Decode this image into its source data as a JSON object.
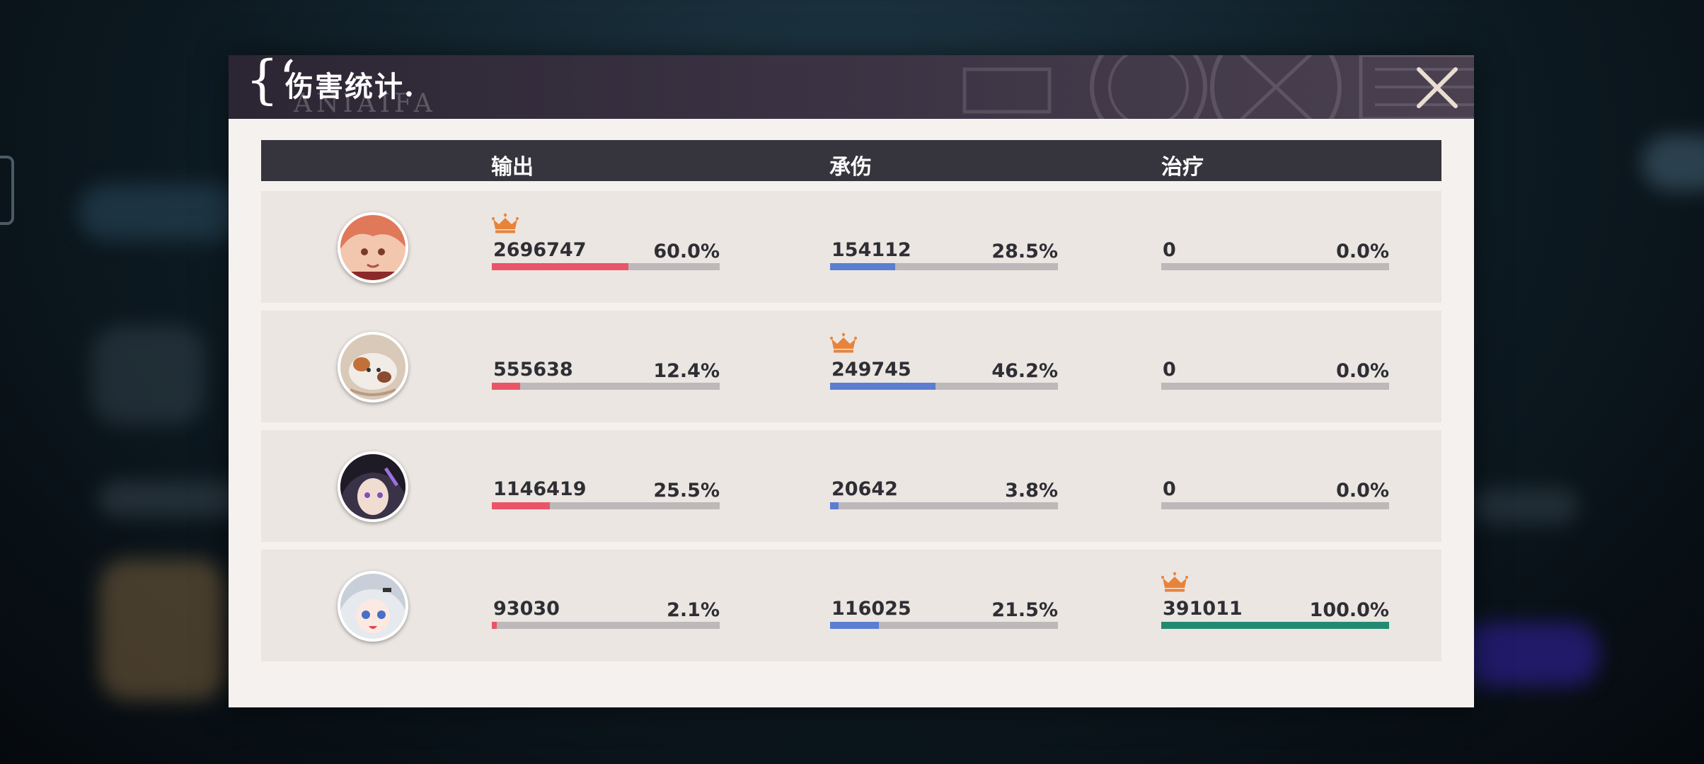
{
  "dialog": {
    "title": "伤害统计",
    "brace": "{‘",
    "title_dot": ".",
    "ghost_text": "ANIAIFA"
  },
  "columns": {
    "output": "输出",
    "damage_taken": "承伤",
    "healing": "治疗"
  },
  "colors": {
    "output_bar": "#ea5468",
    "damage_taken_bar": "#5b7ed3",
    "healing_bar": "#238a72",
    "crown": "#e8833a"
  },
  "rows": [
    {
      "avatar": "character-portrait-orange-hair",
      "output": {
        "value": "2696747",
        "percent_label": "60.0%",
        "fraction": 0.6,
        "top": true
      },
      "damage_taken": {
        "value": "154112",
        "percent_label": "28.5%",
        "fraction": 0.285,
        "top": false
      },
      "healing": {
        "value": "0",
        "percent_label": "0.0%",
        "fraction": 0.0,
        "top": false
      }
    },
    {
      "avatar": "character-portrait-white-cat",
      "output": {
        "value": "555638",
        "percent_label": "12.4%",
        "fraction": 0.124,
        "top": false
      },
      "damage_taken": {
        "value": "249745",
        "percent_label": "46.2%",
        "fraction": 0.462,
        "top": true
      },
      "healing": {
        "value": "0",
        "percent_label": "0.0%",
        "fraction": 0.0,
        "top": false
      }
    },
    {
      "avatar": "character-portrait-dark-hair",
      "output": {
        "value": "1146419",
        "percent_label": "25.5%",
        "fraction": 0.255,
        "top": false
      },
      "damage_taken": {
        "value": "20642",
        "percent_label": "3.8%",
        "fraction": 0.038,
        "top": false
      },
      "healing": {
        "value": "0",
        "percent_label": "0.0%",
        "fraction": 0.0,
        "top": false
      }
    },
    {
      "avatar": "character-portrait-silver-hair",
      "output": {
        "value": "93030",
        "percent_label": "2.1%",
        "fraction": 0.021,
        "top": false
      },
      "damage_taken": {
        "value": "116025",
        "percent_label": "21.5%",
        "fraction": 0.215,
        "top": false
      },
      "healing": {
        "value": "391011",
        "percent_label": "100.0%",
        "fraction": 1.0,
        "top": true
      }
    }
  ]
}
